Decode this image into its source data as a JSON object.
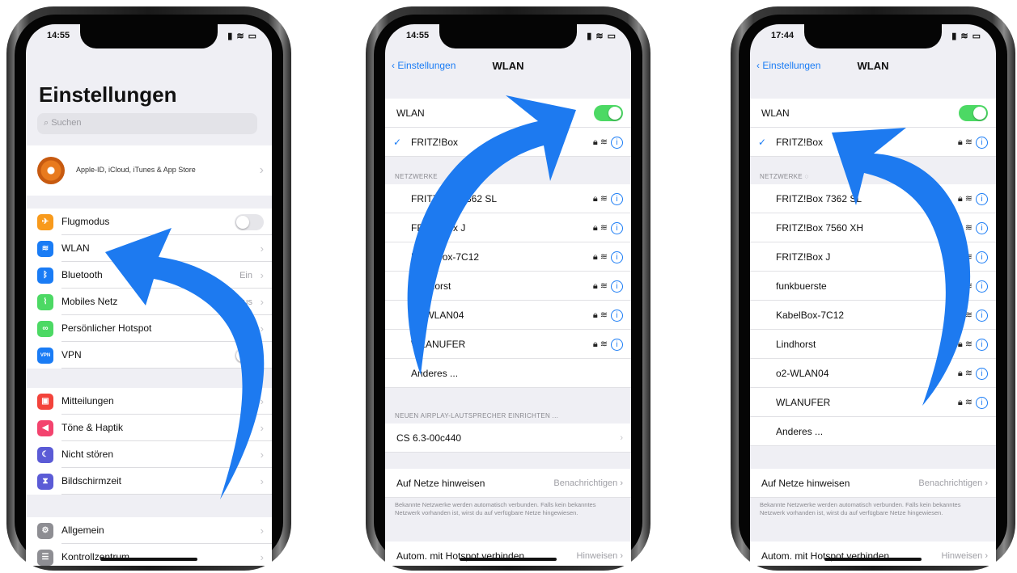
{
  "phone1": {
    "time": "14:55",
    "title": "Einstellungen",
    "search_placeholder": "Suchen",
    "apple_id_text": "Apple-ID, iCloud, iTunes & App Store",
    "group1": [
      {
        "label": "Flugmodus",
        "icon": "airplane-icon",
        "color": "#f89a1c",
        "glyph": "✈"
      },
      {
        "label": "WLAN",
        "icon": "wifi-icon",
        "color": "#1a7cf5",
        "glyph": "≋"
      },
      {
        "label": "Bluetooth",
        "icon": "bluetooth-icon",
        "color": "#1a7cf5",
        "glyph": "ᛒ",
        "value": "Ein"
      },
      {
        "label": "Mobiles Netz",
        "icon": "cellular-icon",
        "color": "#4cd964",
        "glyph": "⌇",
        "value": "us"
      },
      {
        "label": "Persönlicher Hotspot",
        "icon": "hotspot-icon",
        "color": "#4cd964",
        "glyph": "∞"
      },
      {
        "label": "VPN",
        "icon": "vpn-icon",
        "color": "#1a7cf5",
        "glyph": "VPN"
      }
    ],
    "group2": [
      {
        "label": "Mitteilungen",
        "icon": "notifications-icon",
        "color": "#f3433b",
        "glyph": "▣"
      },
      {
        "label": "Töne & Haptik",
        "icon": "sounds-icon",
        "color": "#f3436e",
        "glyph": "◀"
      },
      {
        "label": "Nicht stören",
        "icon": "do-not-disturb-icon",
        "color": "#5b5bd6",
        "glyph": "☾"
      },
      {
        "label": "Bildschirmzeit",
        "icon": "screen-time-icon",
        "color": "#5b5bd6",
        "glyph": "⧗"
      }
    ],
    "group3": [
      {
        "label": "Allgemein",
        "icon": "general-icon",
        "color": "#8e8e93",
        "glyph": "⚙"
      },
      {
        "label": "Kontrollzentrum",
        "icon": "control-center-icon",
        "color": "#8e8e93",
        "glyph": "☰"
      }
    ]
  },
  "phone2": {
    "time": "14:55",
    "back_label": "Einstellungen",
    "title": "WLAN",
    "wlan_label": "WLAN",
    "connected": "FRITZ!Box",
    "networks_label": "NETZWERKE",
    "networks": [
      "FRITZ!Box 7362 SL",
      "FRITZ!Box J",
      "KabelBox-7C12",
      "Lindhorst",
      "o2-WLAN04",
      "WLANUFER"
    ],
    "other": "Anderes ...",
    "airplay_label": "NEUEN AIRPLAY-LAUTSPRECHER EINRICHTEN ...",
    "airplay_device": "CS 6.3-00c440",
    "ask_label": "Auf Netze hinweisen",
    "ask_value": "Benachrichtigen",
    "note": "Bekannte Netzwerke werden automatisch verbunden. Falls kein bekanntes Netzwerk vorhanden ist, wirst du auf verfügbare Netze hingewiesen.",
    "hotspot_label": "Autom. mit Hotspot verbinden",
    "hotspot_value": "Hinweisen"
  },
  "phone3": {
    "time": "17:44",
    "back_label": "Einstellungen",
    "title": "WLAN",
    "wlan_label": "WLAN",
    "connected": "FRITZ!Box",
    "networks_label": "NETZWERKE",
    "networks": [
      "FRITZ!Box 7362 SL",
      "FRITZ!Box 7560 XH",
      "FRITZ!Box J",
      "funkbuerste",
      "KabelBox-7C12",
      "Lindhorst",
      "o2-WLAN04",
      "WLANUFER"
    ],
    "other": "Anderes ...",
    "ask_label": "Auf Netze hinweisen",
    "ask_value": "Benachrichtigen",
    "note": "Bekannte Netzwerke werden automatisch verbunden. Falls kein bekanntes Netzwerk vorhanden ist, wirst du auf verfügbare Netze hingewiesen.",
    "hotspot_label": "Autom. mit Hotspot verbinden",
    "hotspot_value": "Hinweisen"
  },
  "colors": {
    "accent": "#1a7cf5",
    "arrow": "#1d7af0",
    "toggle_on": "#4cd964"
  }
}
